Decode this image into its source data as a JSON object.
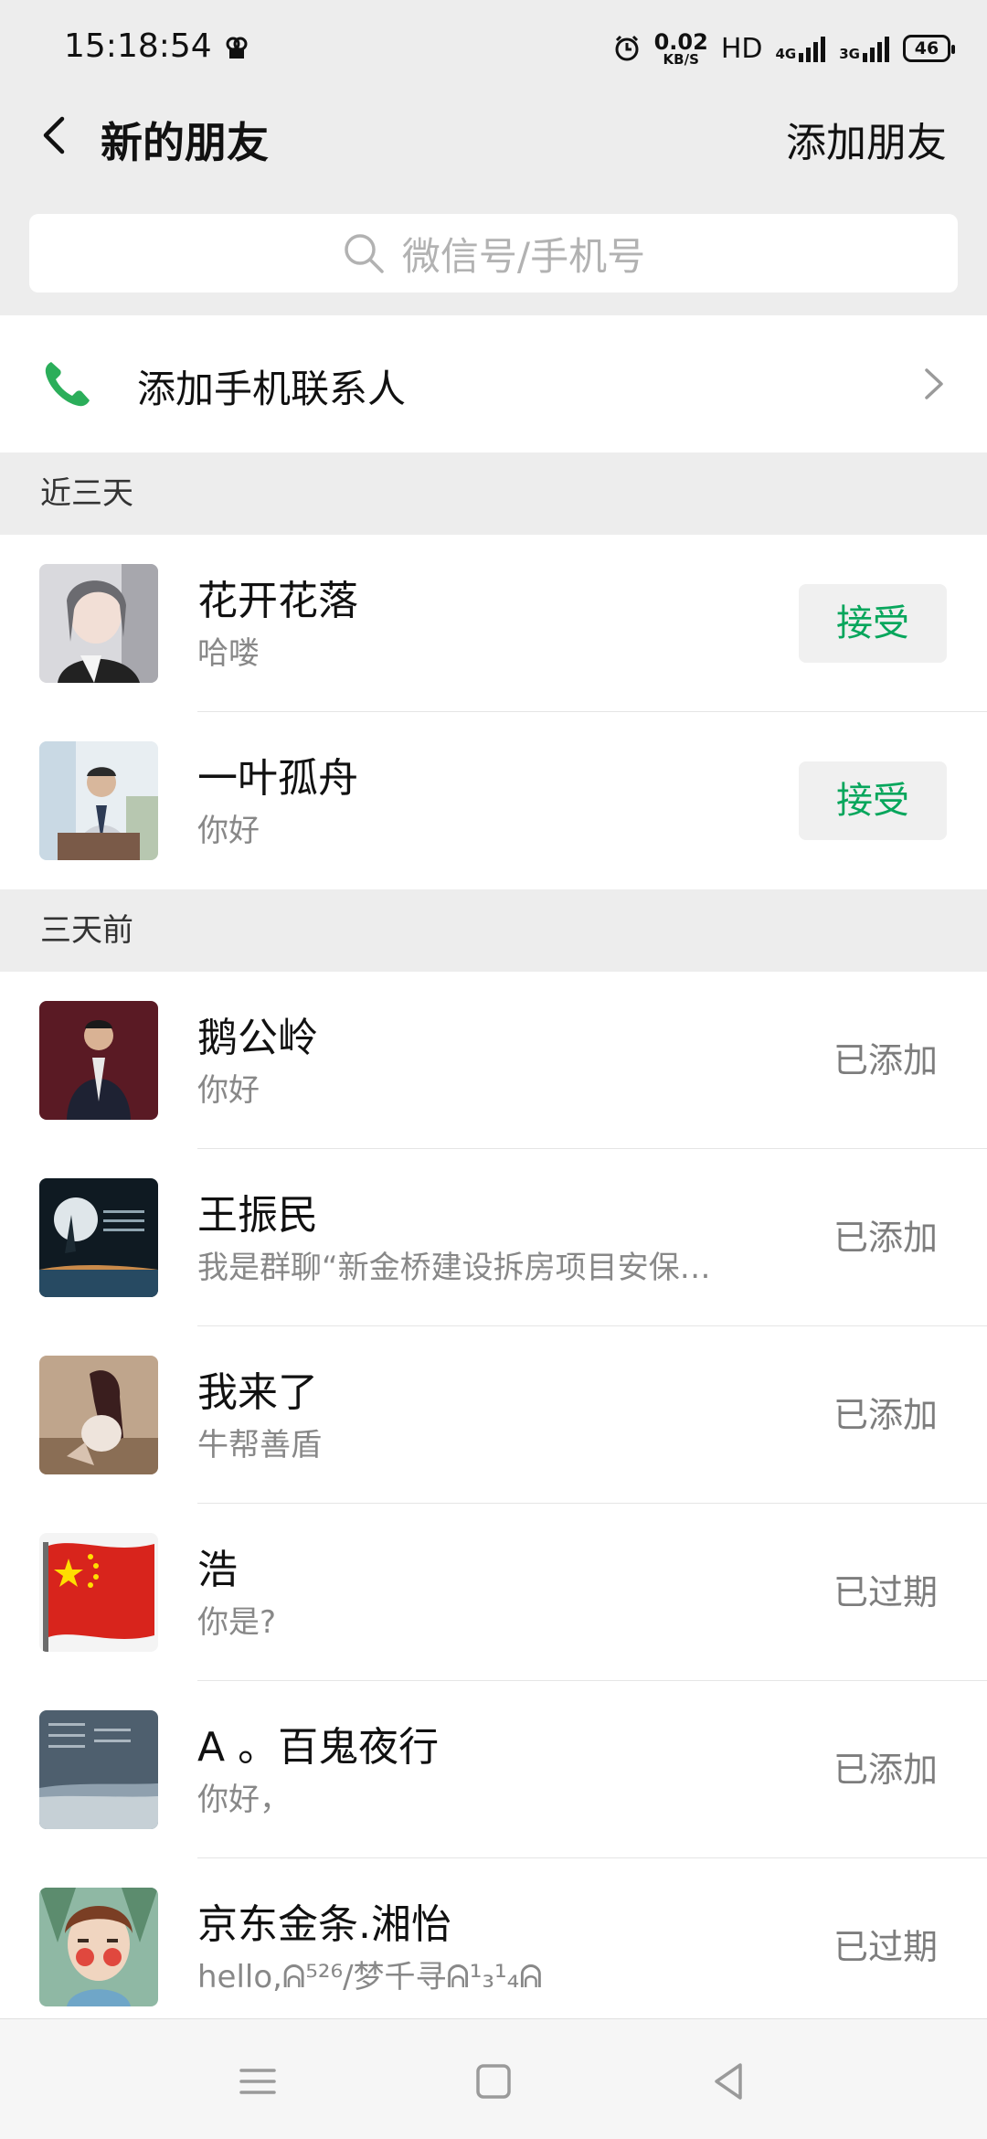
{
  "status_bar": {
    "time": "15:18:54",
    "net_speed_value": "0.02",
    "net_speed_unit": "KB/S",
    "hd_label": "HD",
    "net1": "4G",
    "net2": "3G",
    "battery": "46"
  },
  "nav": {
    "title": "新的朋友",
    "add_friend": "添加朋友"
  },
  "search": {
    "placeholder": "微信号/手机号"
  },
  "add_contacts": {
    "label": "添加手机联系人"
  },
  "sections": [
    {
      "title": "近三天"
    },
    {
      "title": "三天前"
    }
  ],
  "recent": [
    {
      "name": "花开花落",
      "message": "哈喽",
      "action": "接受"
    },
    {
      "name": "一叶孤舟",
      "message": "你好",
      "action": "接受"
    }
  ],
  "older": [
    {
      "name": "鹅公岭",
      "message": "你好",
      "status": "已添加"
    },
    {
      "name": "王振民",
      "message": "我是群聊“新金桥建设拆房项目安保…",
      "status": "已添加"
    },
    {
      "name": "我来了",
      "message": "牛帮善盾",
      "status": "已添加"
    },
    {
      "name": "浩",
      "message": "你是?",
      "status": "已过期"
    },
    {
      "name": "A 。百鬼夜行",
      "message": "你好，",
      "status": "已添加"
    },
    {
      "name": "京东金条.湘怡",
      "message": "hello,ᕱ⁵²⁶/梦千寻ᕱ¹₃¹₄ᕱ",
      "status": "已过期"
    }
  ],
  "colors": {
    "accent_green": "#07a65c",
    "background": "#ededed"
  }
}
